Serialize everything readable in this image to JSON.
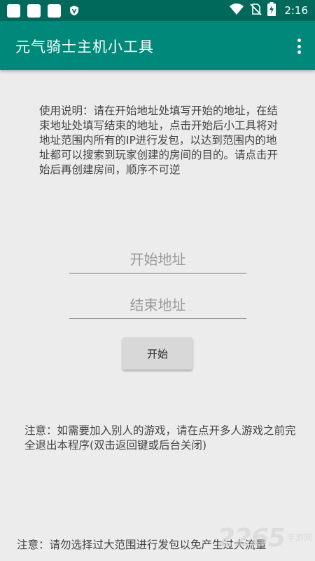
{
  "status_bar": {
    "time": "2:16",
    "notification_icons": [
      "square-notification-icon",
      "square-notification-icon",
      "square-notification-icon",
      "shield-icon"
    ],
    "system_icons": [
      "wifi-icon",
      "no-sim-icon",
      "battery-charging-icon"
    ]
  },
  "app_bar": {
    "title": "元气骑士主机小工具",
    "menu_icon": "overflow-menu-icon",
    "color": "#00897b",
    "status_color": "#00695c"
  },
  "main": {
    "instructions": "使用说明：请在开始地址处填写开始的地址，在结束地址处填写结束的地址，点击开始后小工具将对地址范围内所有的IP进行发包，以达到范围内的地址都可以搜索到玩家创建的房间的目的。请点击开始后再创建房间，顺序不可逆",
    "start_address": {
      "placeholder": "开始地址",
      "value": ""
    },
    "end_address": {
      "placeholder": "结束地址",
      "value": ""
    },
    "start_button": "开始",
    "notice_multiplayer": "注意：如需要加入别人的游戏，请在点开多人游戏之前完全退出本程序(双击返回键或后台关闭)",
    "notice_traffic": "注意：请勿选择过大范围进行发包以免产生过大流量"
  },
  "watermark": {
    "number": "2265",
    "site": "手游网"
  }
}
